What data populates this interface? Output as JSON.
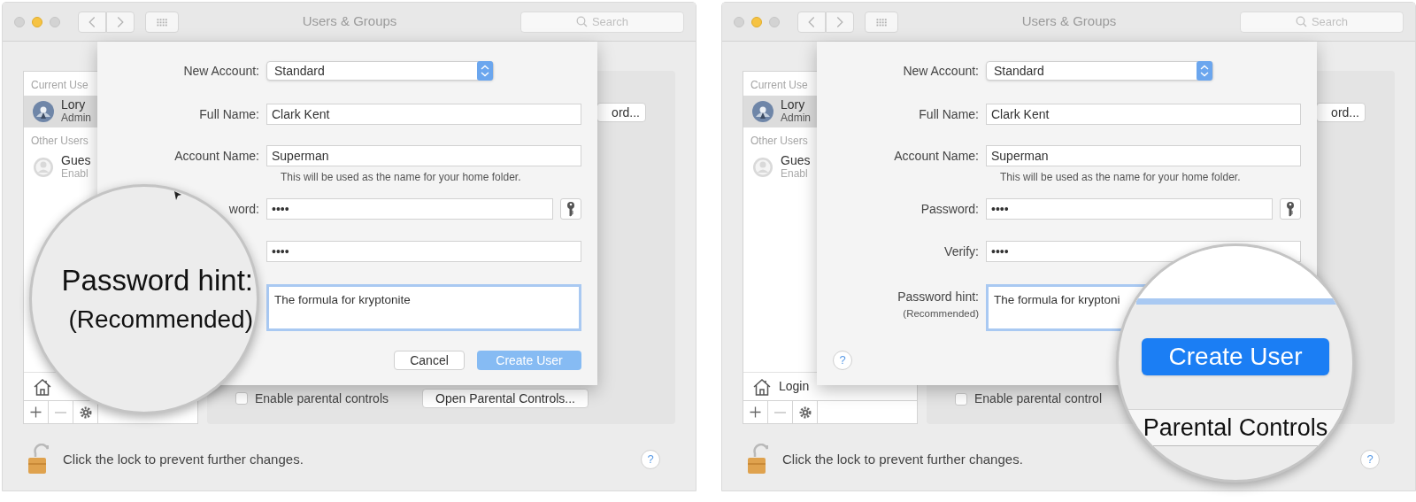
{
  "panels": [
    {
      "window": {
        "title": "Users & Groups",
        "search_placeholder": "Search"
      },
      "sidebar": {
        "sections": [
          {
            "heading": "Current Use",
            "users": [
              {
                "name": "Lory",
                "role": "Admin",
                "selected": true
              }
            ]
          },
          {
            "heading": "Other Users",
            "users": [
              {
                "name": "Gues",
                "role": "Enabl",
                "kind": "generic",
                "selected": false
              }
            ]
          }
        ]
      },
      "background": {
        "password_button": "ord...",
        "parental_checkbox": {
          "label": "Enable parental controls",
          "checked": false
        },
        "parental_button": "Open Parental Controls..."
      },
      "sheet": {
        "rows": [
          {
            "kind": "popup",
            "label": "New Account:",
            "value": "Standard"
          },
          {
            "kind": "text",
            "label": "Full Name:",
            "value": "Clark Kent"
          },
          {
            "kind": "text",
            "label": "Account Name:",
            "value": "Superman",
            "note": "This will be used as the name for your home folder."
          },
          {
            "kind": "password",
            "label": "word:",
            "value": "••••",
            "key_button": true
          },
          {
            "kind": "password",
            "value": "••••",
            "key_button": false
          },
          {
            "kind": "textarea",
            "value": "The formula for kryptonite",
            "focused": true
          }
        ],
        "buttons": [
          {
            "label": "Cancel",
            "kind": "secondary"
          },
          {
            "label": "Create User",
            "kind": "primary"
          }
        ]
      },
      "lock": {
        "text": "Click the lock to prevent further changes.",
        "locked": false
      },
      "help": "?",
      "magnifier": {
        "kind": "hint-label",
        "lines": [
          "Password hint:",
          "(Recommended)"
        ]
      }
    },
    {
      "window": {
        "title": "Users & Groups",
        "search_placeholder": "Search"
      },
      "sidebar": {
        "sections": [
          {
            "heading": "Current Use",
            "users": [
              {
                "name": "Lory",
                "role": "Admin",
                "selected": true
              }
            ]
          },
          {
            "heading": "Other Users",
            "users": [
              {
                "name": "Gues",
                "role": "Enabl",
                "kind": "generic",
                "selected": false
              }
            ]
          }
        ],
        "login_label": "Login"
      },
      "background": {
        "password_button": "ord...",
        "parental_checkbox": {
          "label": "Enable parental control",
          "checked": false
        }
      },
      "sheet": {
        "rows": [
          {
            "kind": "popup",
            "label": "New Account:",
            "value": "Standard"
          },
          {
            "kind": "text",
            "label": "Full Name:",
            "value": "Clark Kent"
          },
          {
            "kind": "text",
            "label": "Account Name:",
            "value": "Superman",
            "note": "This will be used as the name for your home folder."
          },
          {
            "kind": "password",
            "label": "Password:",
            "value": "••••",
            "key_button": true
          },
          {
            "kind": "password",
            "label": "Verify:",
            "value": "••••",
            "key_button": false
          },
          {
            "kind": "textarea",
            "label": "Password hint:",
            "sublabel": "(Recommended)",
            "value": "The formula for kryptoni",
            "focused": true
          }
        ],
        "help": "?"
      },
      "lock": {
        "text": "Click the lock to prevent further changes.",
        "locked": false
      },
      "help": "?",
      "magnifier": {
        "kind": "create-button",
        "button": "Create User",
        "caption": "Parental Controls"
      }
    }
  ]
}
